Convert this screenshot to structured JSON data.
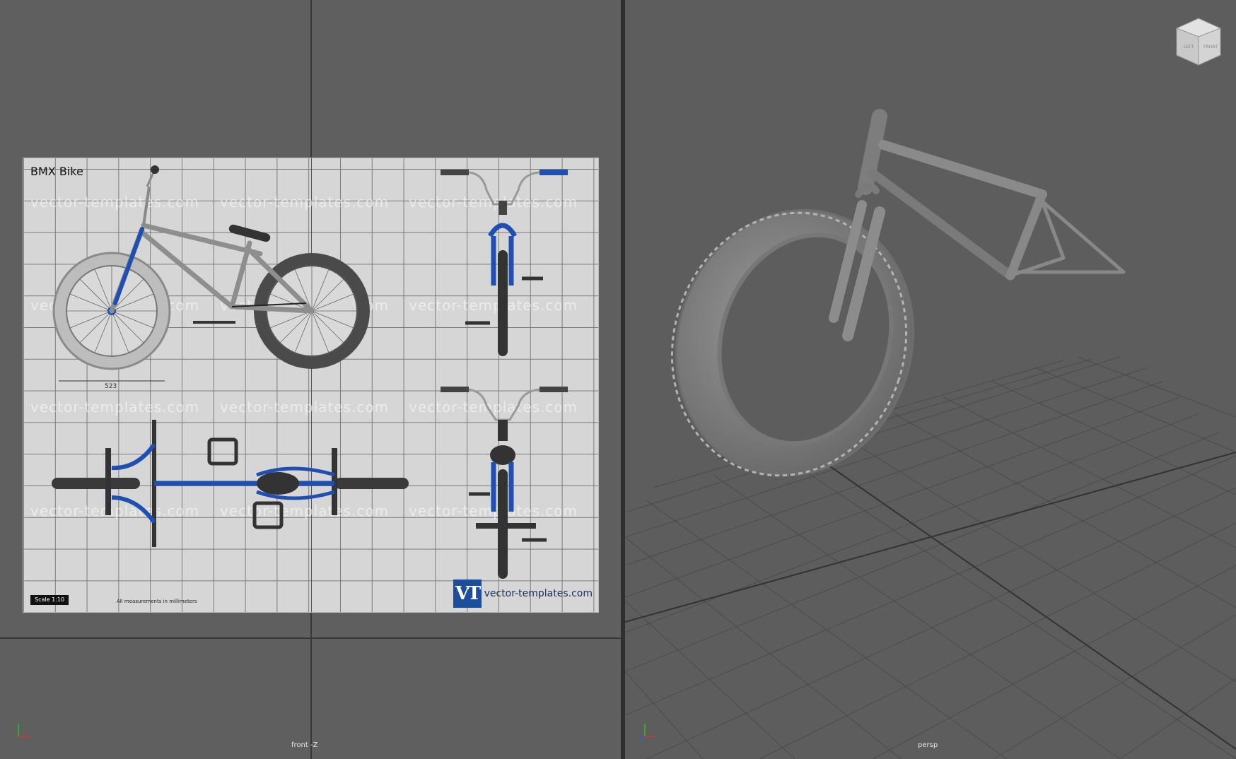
{
  "viewports": {
    "front": {
      "label": "front -Z"
    },
    "persp": {
      "label": "persp"
    }
  },
  "blueprint": {
    "title": "BMX Bike",
    "watermark": "vector-templates.com",
    "dimension": "523",
    "scale_label": "Scale 1:10",
    "measure_note": "All measurements in millimeters",
    "logo_mark": "VT",
    "logo_text": "vector-templates.com"
  },
  "view_cube": {
    "faces": [
      "LEFT",
      "FRONT"
    ]
  },
  "colors": {
    "frame_blue": "#1f4fb0",
    "tire_dark": "#3a3a3a",
    "model_gray": "#8a8a8a",
    "viewport_bg": "#5d5d5d"
  }
}
